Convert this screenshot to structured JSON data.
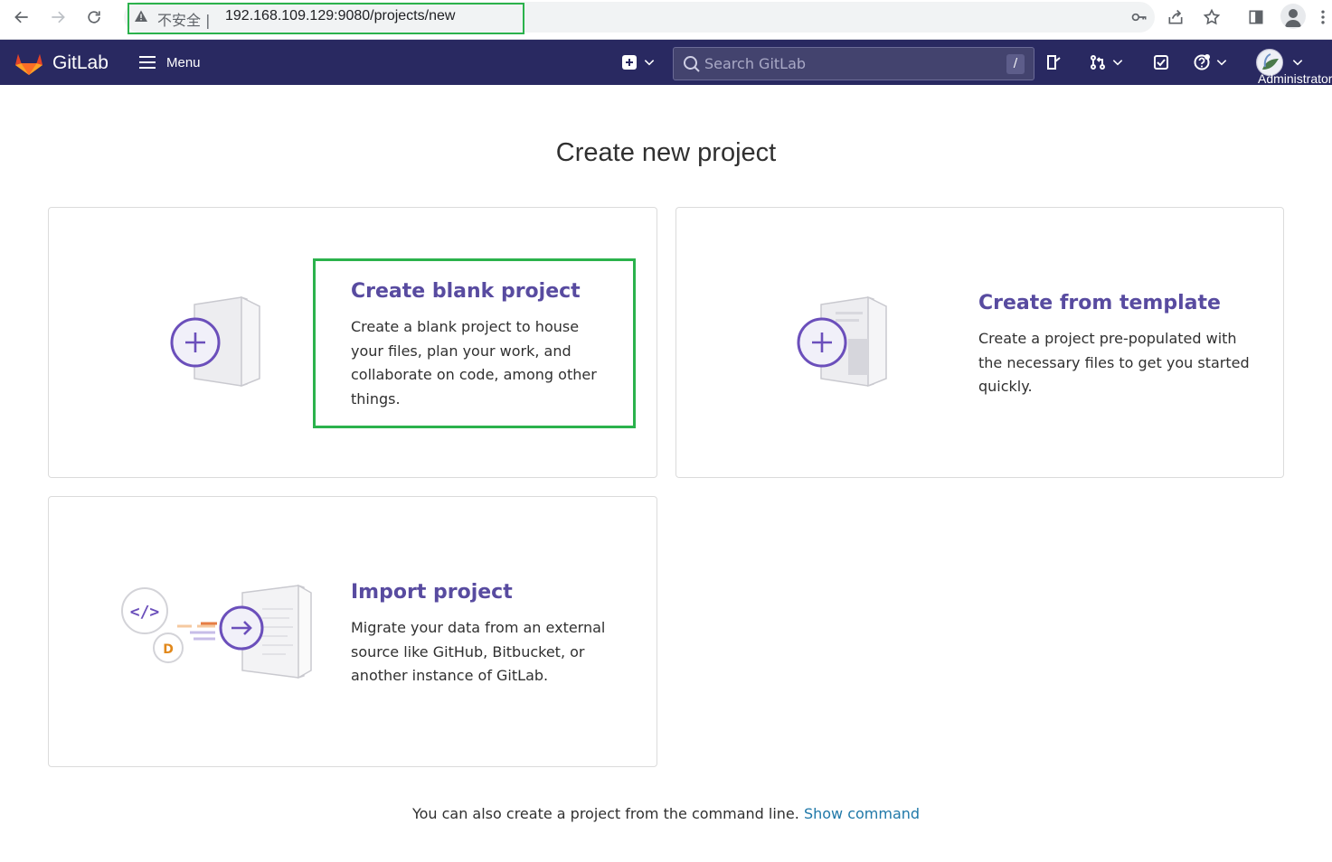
{
  "browser": {
    "security_label": "不安全",
    "separator": "|",
    "url": "192.168.109.129:9080/projects/new"
  },
  "header": {
    "brand": "GitLab",
    "menu_label": "Menu",
    "search_placeholder": "Search GitLab",
    "search_shortcut": "/",
    "user_label": "Administrator",
    "colors": {
      "header_bg": "#292961",
      "accent": "#584ba0",
      "highlight": "#2bb24c"
    }
  },
  "page": {
    "title": "Create new project",
    "cards": {
      "blank": {
        "title": "Create blank project",
        "description": "Create a blank project to house your files, plan your work, and collaborate on code, among other things."
      },
      "template": {
        "title": "Create from template",
        "description": "Create a project pre-populated with the necessary files to get you started quickly."
      },
      "import": {
        "title": "Import project",
        "description": "Migrate your data from an external source like GitHub, Bitbucket, or another instance of GitLab."
      }
    },
    "footer_text": "You can also create a project from the command line.",
    "footer_link": "Show command"
  }
}
